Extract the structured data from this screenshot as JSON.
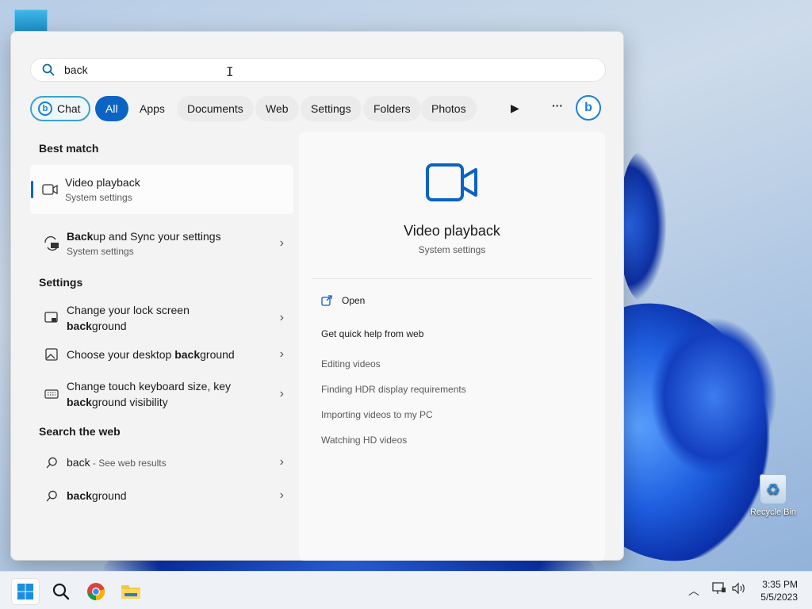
{
  "search": {
    "value": "back"
  },
  "filters": {
    "chat": "Chat",
    "all": "All",
    "apps": "Apps",
    "documents": "Documents",
    "web": "Web",
    "settings": "Settings",
    "folders": "Folders",
    "photos": "Photos"
  },
  "best_match": {
    "heading": "Best match",
    "items": [
      {
        "title": "Video playback",
        "subtitle": "System settings"
      },
      {
        "title_bold": "Back",
        "title_rest": "up and Sync your settings",
        "subtitle": "System settings"
      }
    ]
  },
  "settings_section": {
    "heading": "Settings",
    "items": [
      {
        "line1": "Change your lock screen",
        "bold": "back",
        "rest": "ground"
      },
      {
        "prefix": "Choose your desktop ",
        "bold": "back",
        "rest": "ground"
      },
      {
        "line1": "Change touch keyboard size, key",
        "bold": "back",
        "rest": "ground visibility"
      }
    ]
  },
  "web_section": {
    "heading": "Search the web",
    "items": [
      {
        "query": "back",
        "suffix": " - See web results"
      },
      {
        "bold": "back",
        "rest": "ground"
      }
    ]
  },
  "preview": {
    "title": "Video playback",
    "subtitle": "System settings",
    "open_label": "Open",
    "help_heading": "Get quick help from web",
    "links": [
      "Editing videos",
      "Finding HDR display requirements",
      "Importing videos to my PC",
      "Watching HD videos"
    ]
  },
  "desktop": {
    "recycle_bin": "Recycle Bin"
  },
  "taskbar": {
    "time": "3:35 PM",
    "date": "5/5/2023"
  },
  "colors": {
    "accent": "#0b63c4",
    "wallpaper_blue": "#1f5fe0"
  }
}
